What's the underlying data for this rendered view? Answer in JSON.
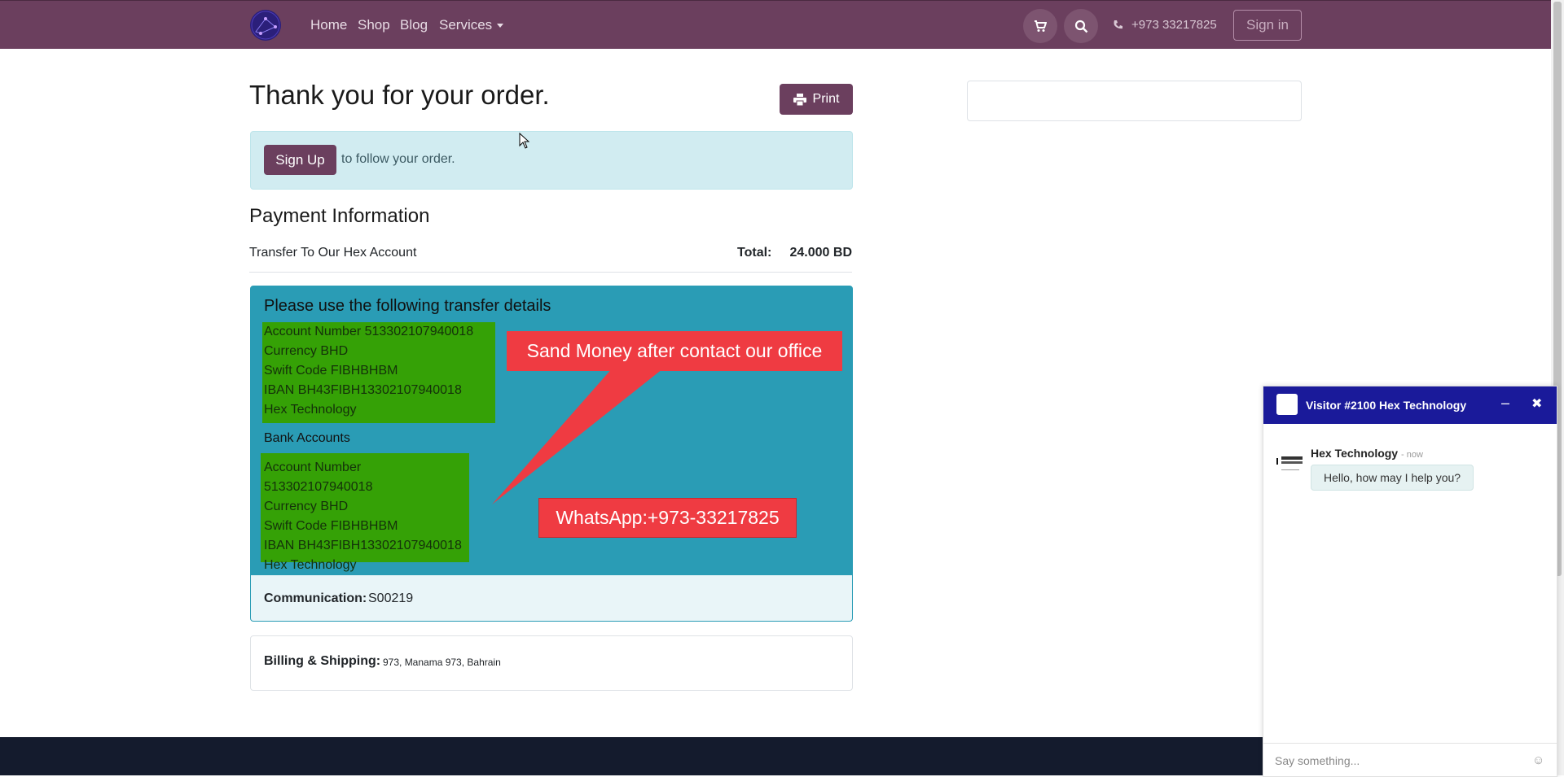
{
  "nav": {
    "links": [
      "Home",
      "Shop",
      "Blog",
      "Services"
    ],
    "phone": "+973 33217825",
    "signin": "Sign in",
    "accent": "#6b3f5e"
  },
  "page": {
    "title": "Thank you for your order.",
    "print": "Print"
  },
  "alert": {
    "signup": "Sign Up",
    "text": "to follow your order."
  },
  "payment": {
    "heading": "Payment Information",
    "method": "Transfer To Our Hex Account",
    "total_label": "Total:",
    "total_value": "24.000 BD"
  },
  "transfer": {
    "heading": "Please use the following transfer details",
    "block1": [
      "Account Number 513302107940018",
      "Currency BHD",
      "Swift Code FIBHBHBM",
      "IBAN BH43FIBH13302107940018",
      "Hex Technology"
    ],
    "bank_label": "Bank Accounts",
    "block2": [
      "Account Number 513302107940018",
      "Currency BHD",
      "Swift Code FIBHBHBM",
      "IBAN BH43FIBH13302107940018",
      "Hex Technology"
    ],
    "callout1": "Sand Money after contact our office",
    "callout2": "WhatsApp:+973-33217825"
  },
  "communication": {
    "label": "Communication:",
    "value": "S00219"
  },
  "billing": {
    "label": "Billing & Shipping:",
    "value": "973, Manama 973, Bahrain"
  },
  "chat": {
    "title": "Visitor #2100 Hex Technology",
    "author": "Hex Technology",
    "time": "- now",
    "message": "Hello, how may I help you?",
    "placeholder": "Say something..."
  }
}
